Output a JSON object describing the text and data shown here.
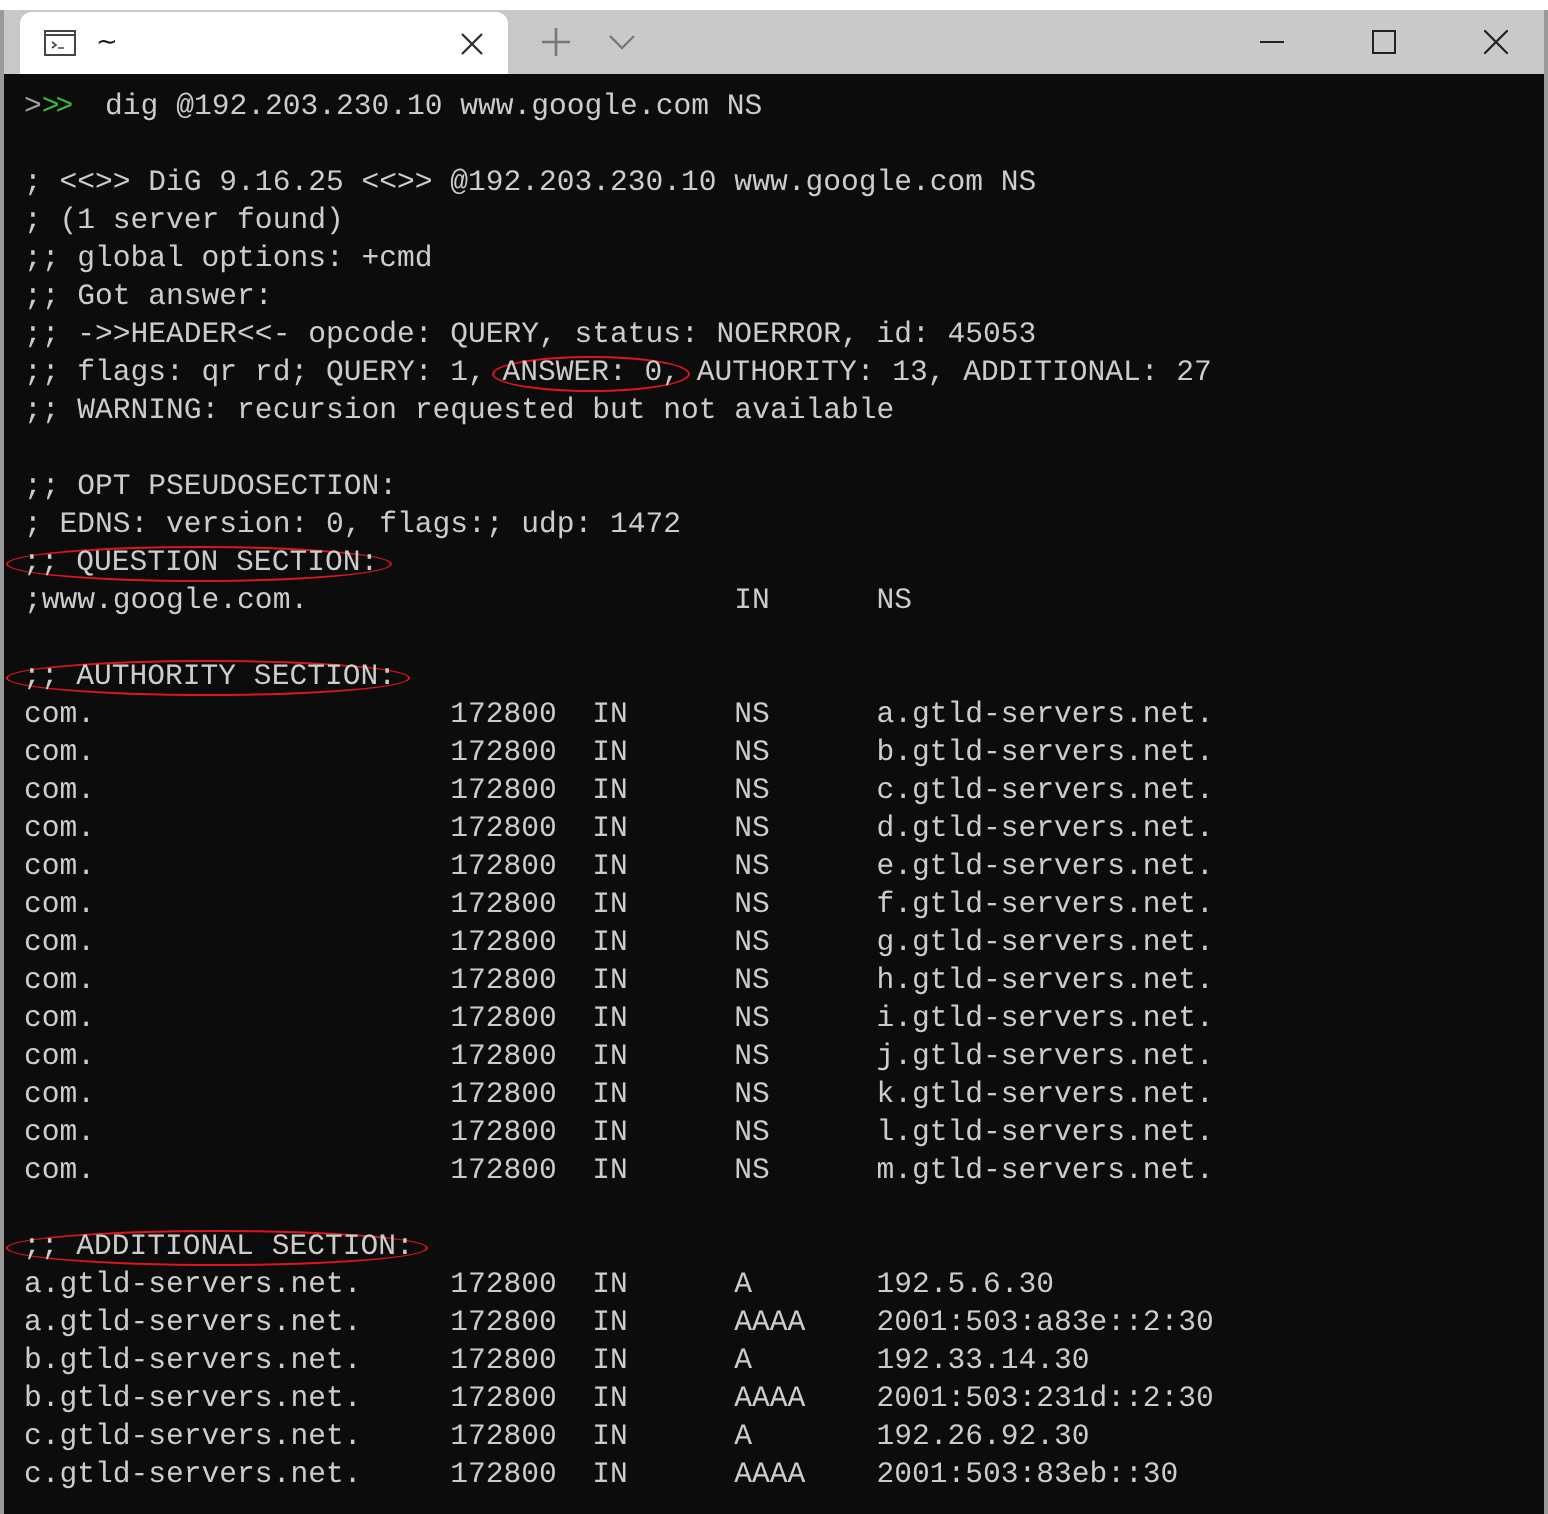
{
  "window": {
    "tabs": [
      {
        "title": "~",
        "selected": true
      }
    ]
  },
  "terminal": {
    "prompt": [
      {
        "text": ">",
        "color": "#a0a0a0"
      },
      {
        "text": ">>",
        "color": "#3cb83c"
      }
    ],
    "command": "dig @192.203.230.10 www.google.com NS",
    "output": [
      {
        "kind": "blank"
      },
      {
        "kind": "line",
        "parts": [
          {
            "text": "; <<>> DiG 9.16.25 <<>> @192.203.230.10 www.google.com NS",
            "circled": false
          }
        ]
      },
      {
        "kind": "line",
        "parts": [
          {
            "text": "; (1 server found)",
            "circled": false
          }
        ]
      },
      {
        "kind": "line",
        "parts": [
          {
            "text": ";; global options: +cmd",
            "circled": false
          }
        ]
      },
      {
        "kind": "line",
        "parts": [
          {
            "text": ";; Got answer:",
            "circled": false
          }
        ]
      },
      {
        "kind": "line",
        "parts": [
          {
            "text": ";; ->>HEADER<<- opcode: QUERY, status: NOERROR, id: 45053",
            "circled": false
          }
        ]
      },
      {
        "kind": "line",
        "parts": [
          {
            "text": ";; flags: qr rd; QUERY: 1, ",
            "circled": false
          },
          {
            "text": "ANSWER: 0,",
            "circled": true
          },
          {
            "text": " AUTHORITY: 13, ADDITIONAL: 27",
            "circled": false
          }
        ]
      },
      {
        "kind": "line",
        "parts": [
          {
            "text": ";; WARNING: recursion requested but not available",
            "circled": false
          }
        ]
      },
      {
        "kind": "blank"
      },
      {
        "kind": "line",
        "parts": [
          {
            "text": ";; OPT PSEUDOSECTION:",
            "circled": false
          }
        ]
      },
      {
        "kind": "line",
        "parts": [
          {
            "text": "; EDNS: version: 0, flags:; udp: 1472",
            "circled": false
          }
        ]
      },
      {
        "kind": "heading",
        "text": ";; QUESTION SECTION:",
        "circled": true
      },
      {
        "kind": "question",
        "name": ";www.google.com.",
        "class": "IN",
        "type": "NS"
      },
      {
        "kind": "blank"
      },
      {
        "kind": "heading",
        "text": ";; AUTHORITY SECTION:",
        "circled": true
      },
      {
        "kind": "record",
        "name": "com.",
        "ttl": "172800",
        "class": "IN",
        "type": "NS",
        "data": "a.gtld-servers.net."
      },
      {
        "kind": "record",
        "name": "com.",
        "ttl": "172800",
        "class": "IN",
        "type": "NS",
        "data": "b.gtld-servers.net."
      },
      {
        "kind": "record",
        "name": "com.",
        "ttl": "172800",
        "class": "IN",
        "type": "NS",
        "data": "c.gtld-servers.net."
      },
      {
        "kind": "record",
        "name": "com.",
        "ttl": "172800",
        "class": "IN",
        "type": "NS",
        "data": "d.gtld-servers.net."
      },
      {
        "kind": "record",
        "name": "com.",
        "ttl": "172800",
        "class": "IN",
        "type": "NS",
        "data": "e.gtld-servers.net."
      },
      {
        "kind": "record",
        "name": "com.",
        "ttl": "172800",
        "class": "IN",
        "type": "NS",
        "data": "f.gtld-servers.net."
      },
      {
        "kind": "record",
        "name": "com.",
        "ttl": "172800",
        "class": "IN",
        "type": "NS",
        "data": "g.gtld-servers.net."
      },
      {
        "kind": "record",
        "name": "com.",
        "ttl": "172800",
        "class": "IN",
        "type": "NS",
        "data": "h.gtld-servers.net."
      },
      {
        "kind": "record",
        "name": "com.",
        "ttl": "172800",
        "class": "IN",
        "type": "NS",
        "data": "i.gtld-servers.net."
      },
      {
        "kind": "record",
        "name": "com.",
        "ttl": "172800",
        "class": "IN",
        "type": "NS",
        "data": "j.gtld-servers.net."
      },
      {
        "kind": "record",
        "name": "com.",
        "ttl": "172800",
        "class": "IN",
        "type": "NS",
        "data": "k.gtld-servers.net."
      },
      {
        "kind": "record",
        "name": "com.",
        "ttl": "172800",
        "class": "IN",
        "type": "NS",
        "data": "l.gtld-servers.net."
      },
      {
        "kind": "record",
        "name": "com.",
        "ttl": "172800",
        "class": "IN",
        "type": "NS",
        "data": "m.gtld-servers.net."
      },
      {
        "kind": "blank"
      },
      {
        "kind": "heading",
        "text": ";; ADDITIONAL SECTION:",
        "circled": true
      },
      {
        "kind": "record",
        "name": "a.gtld-servers.net.",
        "ttl": "172800",
        "class": "IN",
        "type": "A",
        "data": "192.5.6.30"
      },
      {
        "kind": "record",
        "name": "a.gtld-servers.net.",
        "ttl": "172800",
        "class": "IN",
        "type": "AAAA",
        "data": "2001:503:a83e::2:30"
      },
      {
        "kind": "record",
        "name": "b.gtld-servers.net.",
        "ttl": "172800",
        "class": "IN",
        "type": "A",
        "data": "192.33.14.30"
      },
      {
        "kind": "record",
        "name": "b.gtld-servers.net.",
        "ttl": "172800",
        "class": "IN",
        "type": "AAAA",
        "data": "2001:503:231d::2:30"
      },
      {
        "kind": "record",
        "name": "c.gtld-servers.net.",
        "ttl": "172800",
        "class": "IN",
        "type": "A",
        "data": "192.26.92.30"
      },
      {
        "kind": "record",
        "name": "c.gtld-servers.net.",
        "ttl": "172800",
        "class": "IN",
        "type": "AAAA",
        "data": "2001:503:83eb::30"
      }
    ]
  }
}
